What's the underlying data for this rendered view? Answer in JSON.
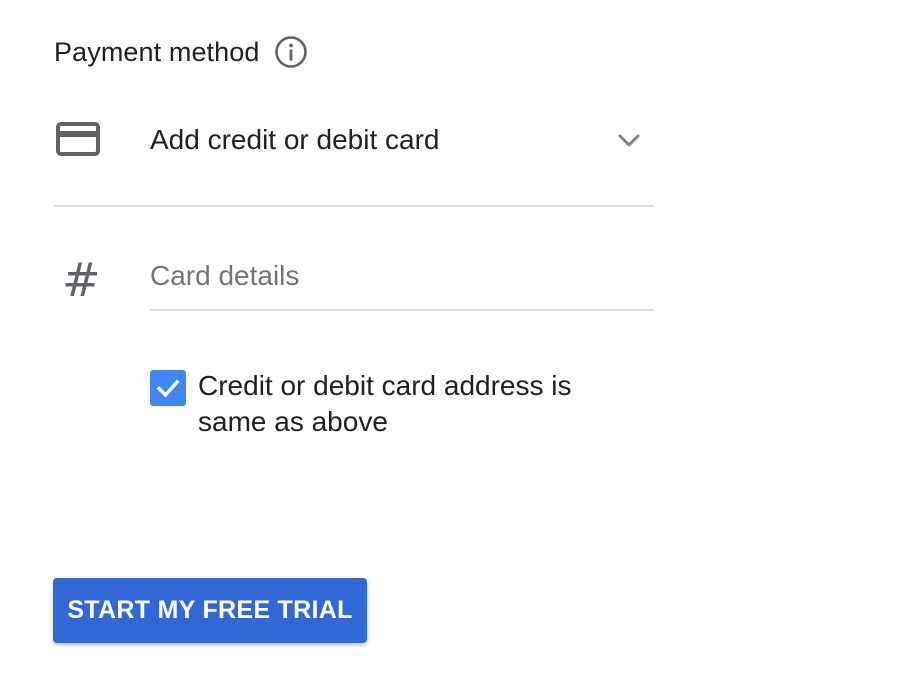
{
  "payment": {
    "title": "Payment method",
    "info_icon": "info-icon",
    "method_icon": "credit-card-icon",
    "method_label": "Add credit or debit card",
    "dropdown_icon": "chevron-down-icon"
  },
  "card_details": {
    "icon": "hash-icon",
    "icon_glyph": "#",
    "value": "",
    "placeholder": "Card details"
  },
  "address_checkbox": {
    "checked": true,
    "label": "Credit or debit card address is same as above",
    "color": "#4285f4"
  },
  "submit": {
    "label": "START MY FREE TRIAL",
    "color": "#3367d6"
  }
}
